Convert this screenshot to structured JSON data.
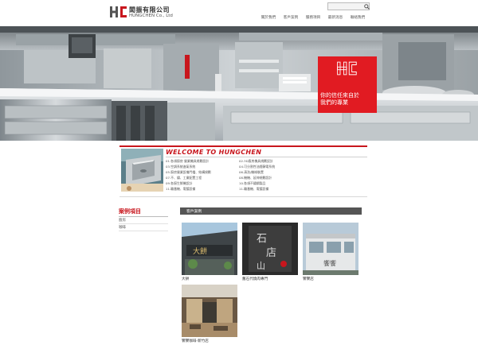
{
  "header": {
    "logo_mark": "HC",
    "logo_zh": "閎振有限公司",
    "logo_en": "HUNGCHEN Co., Ltd",
    "search_value": ""
  },
  "nav": [
    {
      "label": "關於我們"
    },
    {
      "label": "客戶案例"
    },
    {
      "label": "服務項目"
    },
    {
      "label": "最新消息"
    },
    {
      "label": "聯絡我們"
    }
  ],
  "hero": {
    "tag_mark": "HC",
    "tagline_line1": "你的信任來自於",
    "tagline_line2": "我們的專業"
  },
  "welcome": {
    "title": "WELCOME TO HUNGCHEN",
    "services_left": [
      "01.各項廚房 營業機具規劃設計",
      "03.空調系統進氣系統",
      "05.廚房營業設備門檔、結構規劃",
      "07.不、鏽、工業配置工程",
      "09.各廚生鮮機設計",
      "11.輪番機、電鍍設備"
    ],
    "services_right": [
      "02.3D廚房機具規劃設計",
      "04.可分割性油煙靜電系統",
      "06.清洗/機械裝置",
      "08.機機、延伸規劃設計",
      "10.各項不鏽鋼製品",
      "11.輪番機、電鍍設備"
    ]
  },
  "sidebar": {
    "title": "案例項目",
    "items": [
      {
        "label": "廚房"
      },
      {
        "label": "咖啡"
      }
    ]
  },
  "main": {
    "section_title": "客戶案例",
    "cases": [
      {
        "caption": "大餅"
      },
      {
        "caption": "舊石代燒肉專門"
      },
      {
        "caption": "饗饗店"
      },
      {
        "caption": "饗饗咖啡-新竹店"
      }
    ]
  },
  "colors": {
    "brand_red": "#c8161d",
    "tag_red": "#e11b22",
    "head_bar": "#555555"
  }
}
